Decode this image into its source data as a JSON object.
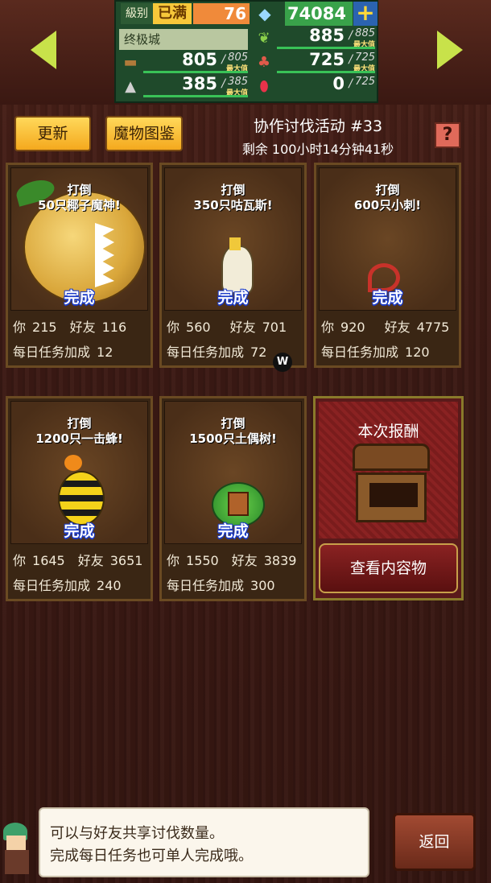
{
  "header": {
    "level_label": "級别",
    "level_status": "已满",
    "level_value": "76",
    "city_name": "终极城",
    "gems": "74084",
    "resources": [
      {
        "icon": "leaf-icon",
        "value": "885",
        "max": "885",
        "max_label": "最大值"
      },
      {
        "icon": "wood-icon",
        "value": "805",
        "max": "805",
        "max_label": "最大值"
      },
      {
        "icon": "food-icon",
        "value": "725",
        "max": "725",
        "max_label": "最大值"
      },
      {
        "icon": "ore-icon",
        "value": "385",
        "max": "385",
        "max_label": "最大值"
      },
      {
        "icon": "ruby-icon",
        "value": "0",
        "max": "725"
      }
    ],
    "slash": "/",
    "plus": "+"
  },
  "toolbar": {
    "refresh": "更新",
    "bestiary": "魔物图鉴",
    "event_title": "协作讨伐活动 #33",
    "event_remaining": "剩余 100小时14分钟41秒",
    "help": "?"
  },
  "labels": {
    "you": "你",
    "friend": "好友",
    "daily_bonus": "每日任务加成",
    "done": "完成"
  },
  "cards": [
    {
      "line1": "打倒",
      "line2": "50只椰子魔神!",
      "you": "215",
      "friend": "116",
      "bonus": "12"
    },
    {
      "line1": "打倒",
      "line2": "350只咕瓦斯!",
      "you": "560",
      "friend": "701",
      "bonus": "72"
    },
    {
      "line1": "打倒",
      "line2": "600只小刺!",
      "you": "920",
      "friend": "4775",
      "bonus": "120"
    },
    {
      "line1": "打倒",
      "line2": "1200只一击蜂!",
      "you": "1645",
      "friend": "3651",
      "bonus": "240"
    },
    {
      "line1": "打倒",
      "line2": "1500只土偶树!",
      "you": "1550",
      "friend": "3839",
      "bonus": "300"
    }
  ],
  "reward": {
    "title": "本次报酬",
    "button": "查看内容物"
  },
  "dialog": {
    "line1": "可以与好友共享讨伐数量。",
    "line2": "完成每日任务也可单人完成哦。"
  },
  "back": "返回",
  "badge": "W",
  "colors": {
    "accent_gold": "#f4a91e",
    "done_blue": "#1a3ac8",
    "stat_green": "#39c257"
  }
}
